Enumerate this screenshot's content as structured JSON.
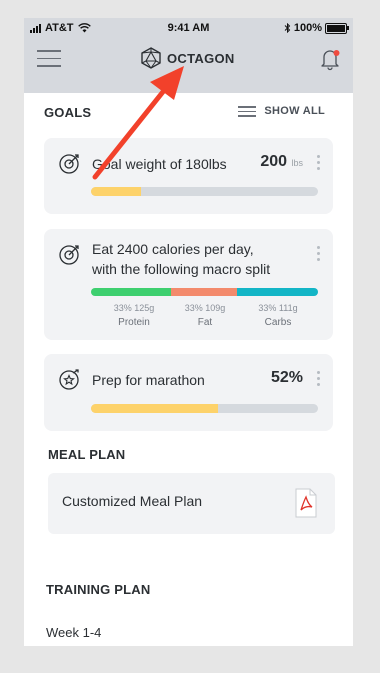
{
  "status_bar": {
    "carrier": "AT&T",
    "time": "9:41 AM",
    "battery": "100%",
    "battery_level": 1.0
  },
  "nav": {
    "brand": "OCTAGON",
    "menu_icon": "hamburger-icon",
    "notification_icon": "bell-icon",
    "notification_badge_color": "#ef4b3f"
  },
  "goals": {
    "heading": "GOALS",
    "show_all": "SHOW ALL",
    "items": [
      {
        "title": "Goal weight of 180lbs",
        "value": "200",
        "unit": "lbs",
        "progress": 0.22,
        "icon": "target-icon"
      },
      {
        "title_line1": "Eat 2400 calories per day,",
        "title_line2": "with the following macro split",
        "icon": "target-icon",
        "macros": [
          {
            "pct": "33%",
            "grams": "125g",
            "name": "Protein",
            "share": 0.353,
            "color": "#3ecf6f"
          },
          {
            "pct": "33%",
            "grams": "109g",
            "name": "Fat",
            "share": 0.292,
            "color": "#f38a6c"
          },
          {
            "pct": "33%",
            "grams": "111g",
            "name": "Carbs",
            "share": 0.355,
            "color": "#13b5c6"
          }
        ]
      },
      {
        "title": "Prep for marathon",
        "value": "52%",
        "progress": 0.56,
        "icon": "star-target-icon"
      }
    ]
  },
  "meal_plan": {
    "heading": "MEAL PLAN",
    "item": "Customized Meal Plan",
    "file_icon": "pdf-icon"
  },
  "training_plan": {
    "heading": "TRAINING PLAN",
    "item": "Week 1-4"
  },
  "colors": {
    "progress_fill": "#fdd26a",
    "progress_track": "#d5d9de",
    "header_bg": "#d6d9de",
    "arrow": "#f2412b"
  }
}
